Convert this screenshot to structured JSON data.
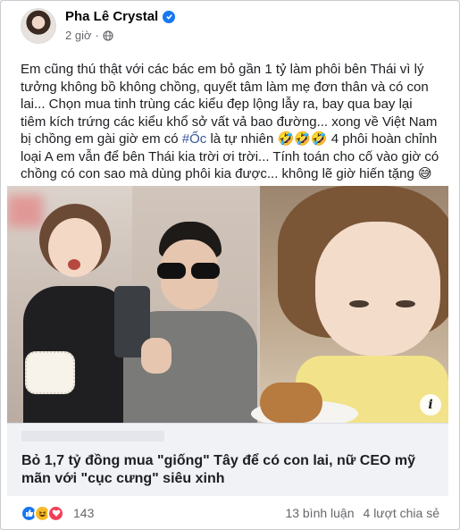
{
  "post": {
    "author": "Pha Lê Crystal",
    "time": "2 giờ",
    "separator": "·",
    "text_before_hashtag": "Em cũng thú thật với các bác em bỏ gần 1 tỷ làm phôi bên Thái vì lý tưởng không bồ không chồng, quyết tâm làm mẹ đơn thân và có con lai... Chọn mua tinh trùng các kiểu đẹp lộng lẫy ra, bay qua bay lại tiêm kích trứng các kiểu khổ sở vất vả bao đường... xong về Việt Nam bị chồng em gài giờ em có ",
    "hashtag": "#Ốc",
    "text_after_hashtag": " là tự nhiên 🤣🤣🤣 4 phôi hoàn chỉnh loại A em vẫn để bên Thái kia trời ơi trời... Tính toán cho cố vào giờ có chồng có con sao mà dùng phôi kia được... không lẽ giờ hiến tặng 😅"
  },
  "link": {
    "title": "Bỏ 1,7 tỷ đồng mua \"giống\" Tây để có con lai, nữ CEO mỹ mãn với \"cục cưng\" siêu xinh",
    "info_glyph": "i"
  },
  "stats": {
    "reaction_count": "143",
    "comments": "13 bình luận",
    "shares": "4 lượt chia sẻ"
  },
  "icons": {
    "verified": "verified-badge-icon",
    "privacy": "globe-icon",
    "reactions": [
      "like-icon",
      "haha-icon",
      "love-icon"
    ]
  },
  "colors": {
    "accent": "#1877f2",
    "hashtag": "#385898",
    "muted": "#65676b"
  }
}
